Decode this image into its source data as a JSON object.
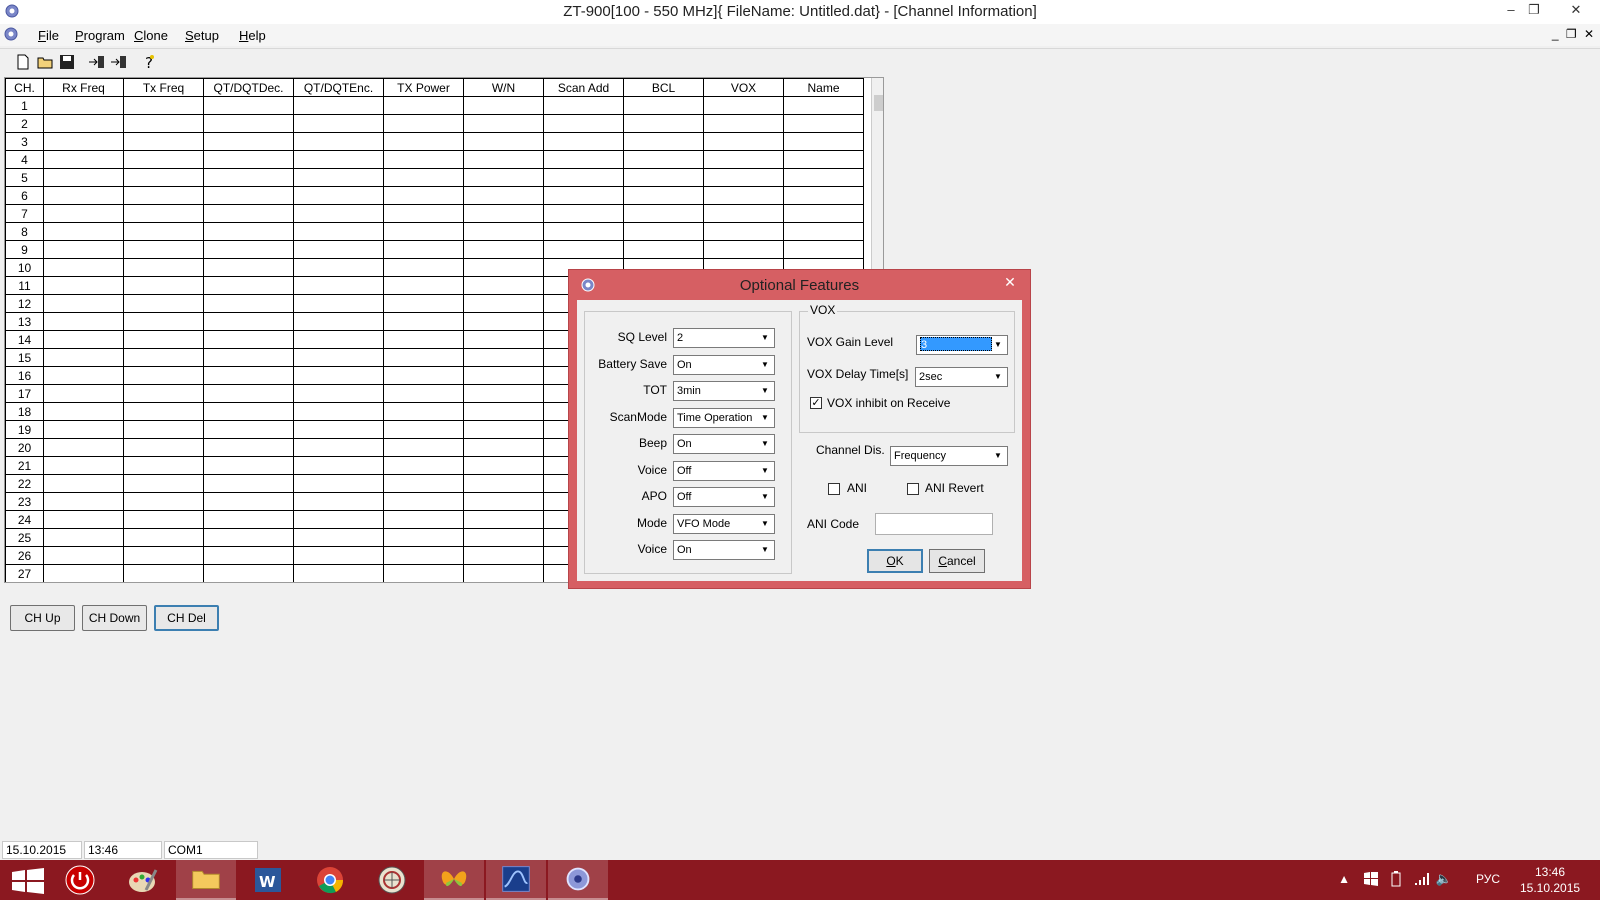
{
  "window": {
    "title": "ZT-900[100 - 550 MHz]{ FileName: Untitled.dat} - [Channel Information]",
    "controls": {
      "minimize": "–",
      "maximize": "❐",
      "close": "✕"
    }
  },
  "menu": {
    "items": [
      {
        "label": "File",
        "key": "F"
      },
      {
        "label": "Program",
        "key": "P"
      },
      {
        "label": "Clone",
        "key": "C"
      },
      {
        "label": "Setup",
        "key": "S"
      },
      {
        "label": "Help",
        "key": "H"
      }
    ],
    "mdi_controls": "_ ❐ ✕"
  },
  "toolbar": {
    "buttons": [
      "new-file-icon",
      "open-folder-icon",
      "save-icon",
      "read-radio-icon",
      "write-radio-icon",
      "help-icon"
    ]
  },
  "grid": {
    "columns": [
      "CH.",
      "Rx Freq",
      "Tx Freq",
      "QT/DQTDec.",
      "QT/DQTEnc.",
      "TX Power",
      "W/N",
      "Scan Add",
      "BCL",
      "VOX",
      "Name"
    ],
    "rows": [
      "1",
      "2",
      "3",
      "4",
      "5",
      "6",
      "7",
      "8",
      "9",
      "10",
      "11",
      "12",
      "13",
      "14",
      "15",
      "16",
      "17",
      "18",
      "19",
      "20",
      "21",
      "22",
      "23",
      "24",
      "25",
      "26",
      "27"
    ]
  },
  "grid_buttons": {
    "ch_up": "CH Up",
    "ch_down": "CH Down",
    "ch_del": "CH Del"
  },
  "statusbar": {
    "date": "15.10.2015",
    "time": "13:46",
    "port": "COM1"
  },
  "dialog": {
    "title": "Optional Features",
    "close": "✕",
    "left_fields": [
      {
        "label": "SQ Level",
        "value": "2"
      },
      {
        "label": "Battery Save",
        "value": "On"
      },
      {
        "label": "TOT",
        "value": "3min"
      },
      {
        "label": "ScanMode",
        "value": "Time Operation"
      },
      {
        "label": "Beep",
        "value": "On"
      },
      {
        "label": "Voice",
        "value": "Off"
      },
      {
        "label": "APO",
        "value": "Off"
      },
      {
        "label": "Mode",
        "value": "VFO Mode"
      },
      {
        "label": "Voice",
        "value": "On"
      }
    ],
    "vox": {
      "group_label": "VOX",
      "gain_label": "VOX Gain Level",
      "gain_value": "3",
      "delay_label": "VOX Delay Time[s]",
      "delay_value": "2sec",
      "inhibit_label": "VOX inhibit on Receive",
      "inhibit_checked": "✓"
    },
    "channel_dis": {
      "label": "Channel Dis.",
      "value": "Frequency"
    },
    "ani_label": "ANI",
    "ani_revert_label": "ANI Revert",
    "ani_code_label": "ANI Code",
    "ani_code_value": "",
    "ok": {
      "label": "OK",
      "key": "O"
    },
    "cancel": {
      "label": "Cancel",
      "key": "C"
    }
  },
  "taskbar": {
    "apps": [
      "windows-start-icon",
      "power-icon",
      "paint-icon",
      "file-explorer-icon",
      "word-icon",
      "chrome-icon",
      "radio-app-icon",
      "butterfly-app-icon",
      "signal-app-icon",
      "zt900-app-icon"
    ],
    "language": "РУС",
    "clock_time": "13:46",
    "clock_date": "15.10.2015"
  },
  "colors": {
    "dialog_frame": "#d65f63",
    "taskbar": "#8b1820",
    "selection": "#3399ff"
  }
}
